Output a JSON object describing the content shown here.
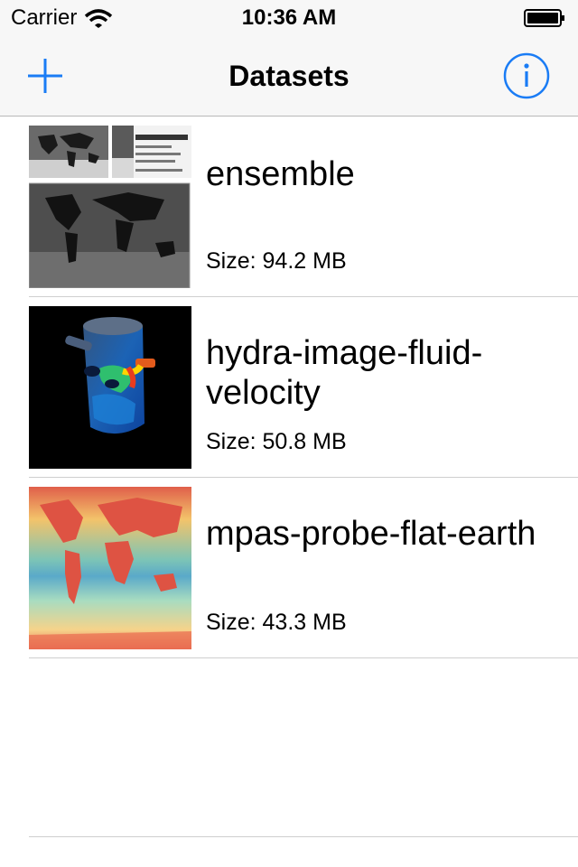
{
  "status_bar": {
    "carrier": "Carrier",
    "time": "10:36 AM"
  },
  "nav": {
    "title": "Datasets",
    "add_icon": "plus-icon",
    "info_icon": "info-icon",
    "tint_color": "#1a7cf5"
  },
  "datasets": [
    {
      "name": "ensemble",
      "size": "Size: 94.2 MB",
      "thumbnail": "world-map-grayscale"
    },
    {
      "name": "hydra-image-fluid-velocity",
      "size": "Size: 50.8 MB",
      "thumbnail": "cylinder-fluid-render"
    },
    {
      "name": "mpas-probe-flat-earth",
      "size": "Size: 43.3 MB",
      "thumbnail": "world-map-color"
    }
  ]
}
